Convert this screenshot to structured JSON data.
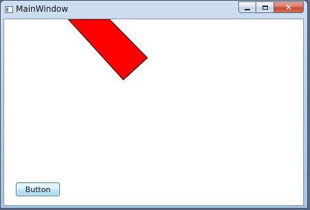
{
  "window": {
    "title": "MainWindow",
    "app_icon": "window-icon",
    "caption_buttons": {
      "minimize_icon": "minimize-icon",
      "maximize_icon": "maximize-icon",
      "close_icon": "close-icon",
      "close_glyph": "✕"
    }
  },
  "canvas": {
    "shape_color": "#ff0000",
    "shape_outline": "#000000"
  },
  "main": {
    "button_label": "Button"
  }
}
